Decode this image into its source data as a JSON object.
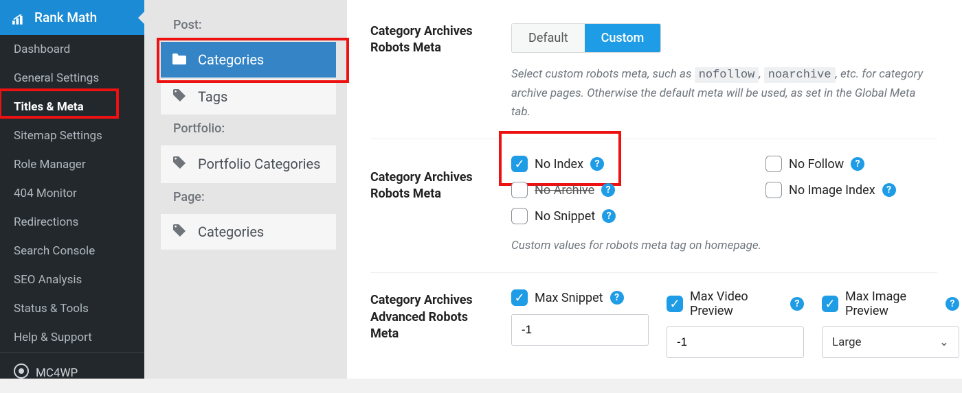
{
  "sidebar": {
    "header": "Rank Math",
    "items": [
      {
        "label": "Dashboard"
      },
      {
        "label": "General Settings"
      },
      {
        "label": "Titles & Meta",
        "active": true
      },
      {
        "label": "Sitemap Settings"
      },
      {
        "label": "Role Manager"
      },
      {
        "label": "404 Monitor"
      },
      {
        "label": "Redirections"
      },
      {
        "label": "Search Console"
      },
      {
        "label": "SEO Analysis"
      },
      {
        "label": "Status & Tools"
      },
      {
        "label": "Help & Support"
      }
    ],
    "footer": "MC4WP"
  },
  "subpanel": {
    "groups": [
      {
        "label": "Post:",
        "tabs": [
          {
            "label": "Categories",
            "icon": "folder",
            "active": true
          },
          {
            "label": "Tags",
            "icon": "tag"
          }
        ]
      },
      {
        "label": "Portfolio:",
        "tabs": [
          {
            "label": "Portfolio Categories",
            "icon": "tag"
          }
        ]
      },
      {
        "label": "Page:",
        "tabs": [
          {
            "label": "Categories",
            "icon": "tag"
          }
        ]
      }
    ]
  },
  "settings": {
    "row1": {
      "label": "Category Archives Robots Meta",
      "seg_default": "Default",
      "seg_custom": "Custom",
      "desc_pre": "Select custom robots meta, such as ",
      "code1": "nofollow",
      "desc_mid": ", ",
      "code2": "noarchive",
      "desc_post": ", etc. for category archive pages. Otherwise the default meta will be used, as set in the Global Meta tab."
    },
    "row2": {
      "label": "Category Archives Robots Meta",
      "opts": {
        "noindex": "No Index",
        "nofollow": "No Follow",
        "noarchive": "No Archive",
        "noimage": "No Image Index",
        "nosnippet": "No Snippet"
      },
      "desc": "Custom values for robots meta tag on homepage."
    },
    "row3": {
      "label": "Category Archives Advanced Robots Meta",
      "max_snippet": "Max Snippet",
      "max_video": "Max Video Preview",
      "max_image": "Max Image Preview",
      "val_snippet": "-1",
      "val_video": "-1",
      "val_image": "Large"
    }
  }
}
